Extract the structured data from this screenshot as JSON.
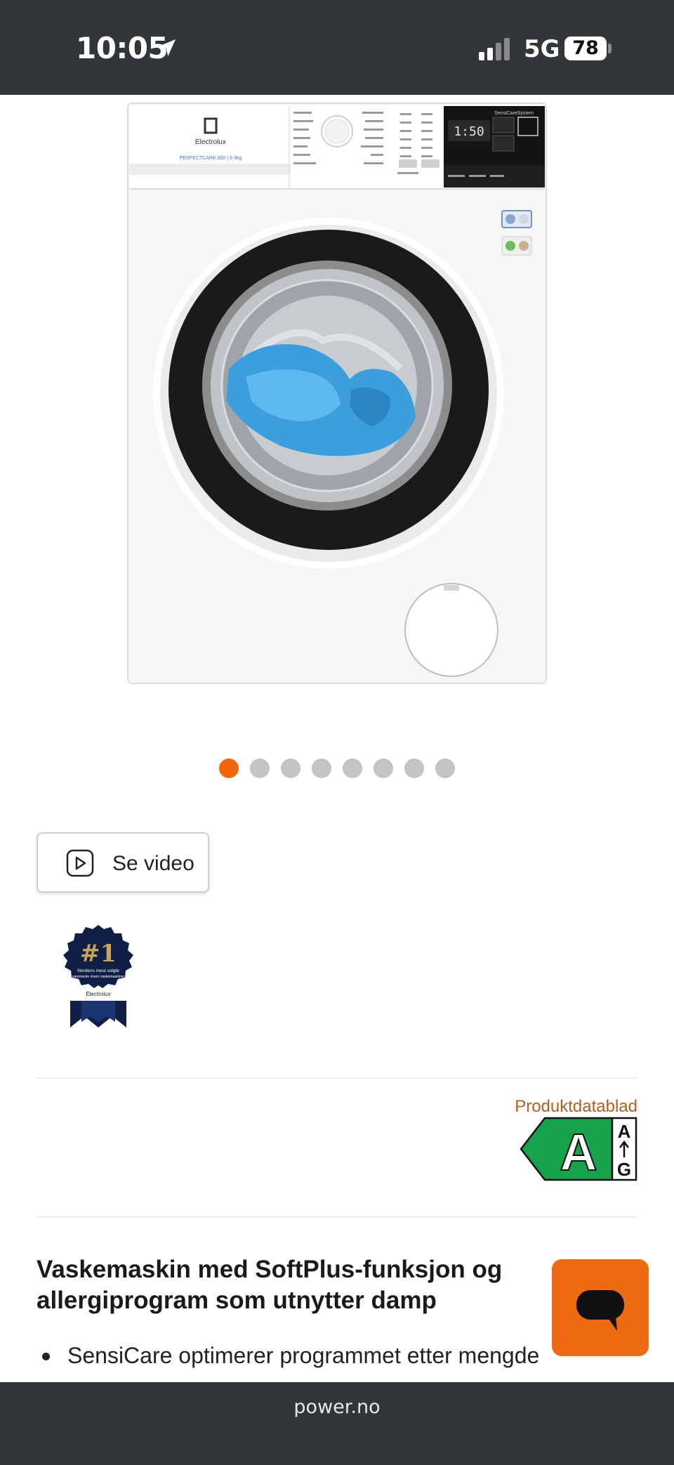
{
  "status_bar": {
    "time": "10:05",
    "network": "5G",
    "battery": "78",
    "icons": [
      "location-arrow-icon",
      "cellular-signal-icon",
      "battery-icon"
    ]
  },
  "product_image": {
    "brand": "Electrolux",
    "series": "PERFECTCARE 600 | 6-9kg",
    "panel_header": "SensiCareSystem",
    "display": "1:50"
  },
  "carousel": {
    "count": 8,
    "active_index": 0
  },
  "video_button": {
    "label": "Se video",
    "icon": "play-icon"
  },
  "badge": {
    "rank": "#1",
    "text_line1": "Nordens mest solgte",
    "text_line2": "varemerke innen vaskemaskiner",
    "brand": "Electrolux"
  },
  "energy": {
    "datasheet_label": "Produktdatablad",
    "class": "A",
    "scale_top": "A",
    "scale_bottom": "G",
    "color": "#16a34a"
  },
  "product": {
    "title": "Vaskemaskin med SoftPlus-funksjon og allergiprogram som utnytter damp",
    "features": [
      "SensiCare optimerer programmet etter mengde"
    ]
  },
  "chat": {
    "icon": "chat-bubble-icon",
    "color": "#ee6a10"
  },
  "browser": {
    "url": "power.no"
  },
  "colors": {
    "accent": "#f2650a",
    "dark_bar": "#333639"
  }
}
